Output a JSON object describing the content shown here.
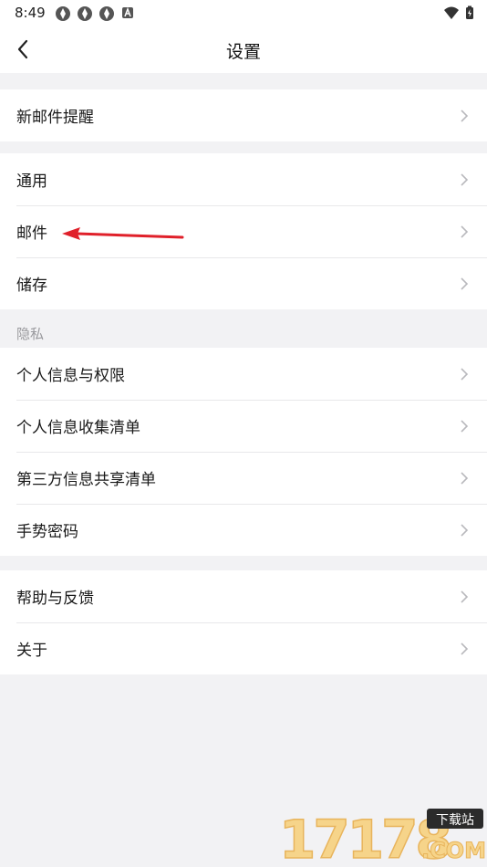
{
  "status_bar": {
    "time": "8:49"
  },
  "header": {
    "title": "设置"
  },
  "groups": [
    {
      "items": [
        {
          "label": "新邮件提醒"
        }
      ]
    },
    {
      "items": [
        {
          "label": "通用"
        },
        {
          "label": "邮件"
        },
        {
          "label": "储存"
        }
      ]
    },
    {
      "section": "隐私",
      "items": [
        {
          "label": "个人信息与权限"
        },
        {
          "label": "个人信息收集清单"
        },
        {
          "label": "第三方信息共享清单"
        },
        {
          "label": "手势密码"
        }
      ]
    },
    {
      "items": [
        {
          "label": "帮助与反馈"
        },
        {
          "label": "关于"
        }
      ]
    }
  ],
  "watermark": {
    "digits": "17178",
    "tag": "下载站",
    "domain": ".COM"
  },
  "colors": {
    "annotation_arrow": "#e0202a",
    "background": "#f2f2f4"
  }
}
